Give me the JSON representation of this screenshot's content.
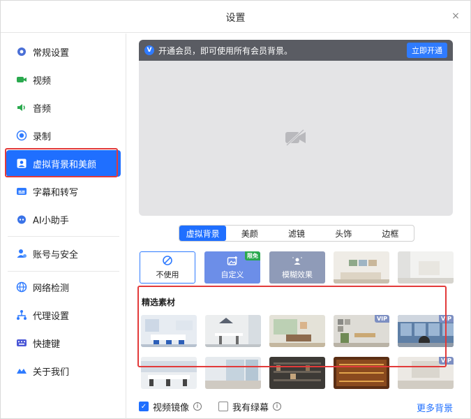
{
  "window": {
    "title": "设置",
    "close_label": "×"
  },
  "sidebar": {
    "items": [
      {
        "label": "常规设置",
        "icon": "gear-icon"
      },
      {
        "label": "视频",
        "icon": "video-icon"
      },
      {
        "label": "音频",
        "icon": "speaker-icon"
      },
      {
        "label": "录制",
        "icon": "record-icon"
      },
      {
        "label": "虚拟背景和美颜",
        "icon": "portrait-icon",
        "active": true
      },
      {
        "label": "字幕和转写",
        "icon": "caption-icon"
      },
      {
        "label": "AI小助手",
        "icon": "robot-icon"
      },
      {
        "label": "账号与安全",
        "icon": "account-icon"
      },
      {
        "label": "网络检测",
        "icon": "globe-icon"
      },
      {
        "label": "代理设置",
        "icon": "network-icon"
      },
      {
        "label": "快捷键",
        "icon": "keyboard-icon"
      },
      {
        "label": "关于我们",
        "icon": "logo-icon"
      }
    ]
  },
  "banner": {
    "text": "开通会员，即可使用所有会员背景。",
    "button": "立即开通",
    "badge": "V"
  },
  "tabs": [
    "虚拟背景",
    "美颜",
    "滤镜",
    "头饰",
    "边框"
  ],
  "active_tab": "虚拟背景",
  "top_row": {
    "none_label": "不使用",
    "custom_label": "自定义",
    "custom_tag": "限免",
    "blur_label": "模糊效果"
  },
  "section": {
    "title": "精选素材"
  },
  "tags": {
    "vip": "VIP"
  },
  "footer": {
    "mirror_label": "视频镜像",
    "mirror_checked": true,
    "green_label": "我有绿幕",
    "green_checked": false,
    "more_label": "更多背景",
    "info_glyph": "i"
  },
  "colors": {
    "accent": "#1f6fff",
    "highlight_box": "#e23a3a",
    "vip": "#7d8fc2",
    "free": "#2aa94e"
  }
}
